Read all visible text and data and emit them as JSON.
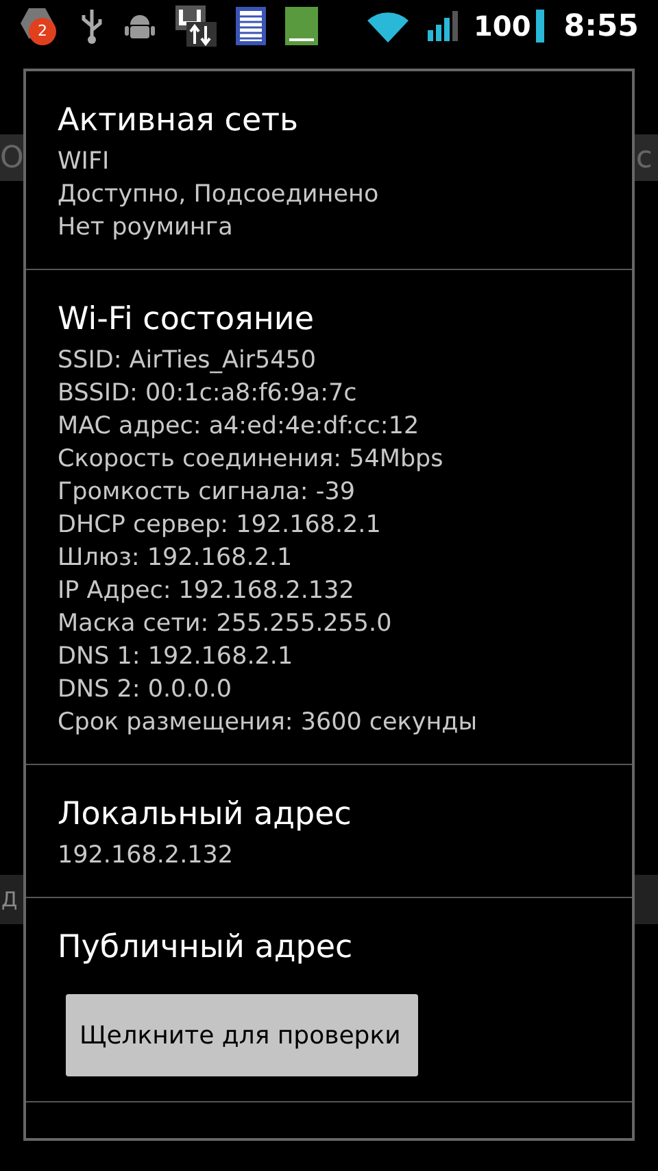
{
  "status_bar": {
    "notification_count": "2",
    "battery": "100",
    "time": "8:55"
  },
  "background": {
    "top_left": "О",
    "top_right": "с",
    "bottom_left": "Д"
  },
  "dialog": {
    "sections": [
      {
        "title": "Активная сеть",
        "lines": [
          "WIFI",
          "Доступно, Подсоединено",
          "Нет роуминга"
        ]
      },
      {
        "title": "Wi-Fi состояние",
        "lines": [
          "SSID: AirTies_Air5450",
          "BSSID: 00:1c:a8:f6:9a:7c",
          "MAC адрес: a4:ed:4e:df:cc:12",
          "Скорость соединения: 54Mbps",
          "Громкость сигнала: -39",
          "DHCP сервер: 192.168.2.1",
          "Шлюз: 192.168.2.1",
          "IP Адрес: 192.168.2.132",
          "Маска сети: 255.255.255.0",
          "DNS 1: 192.168.2.1",
          "DNS 2: 0.0.0.0",
          "Срок размещения: 3600 секунды"
        ]
      },
      {
        "title": "Локальный адрес",
        "lines": [
          "192.168.2.132"
        ]
      },
      {
        "title": "Публичный адрес",
        "button": "Щелкните для проверки"
      }
    ]
  }
}
